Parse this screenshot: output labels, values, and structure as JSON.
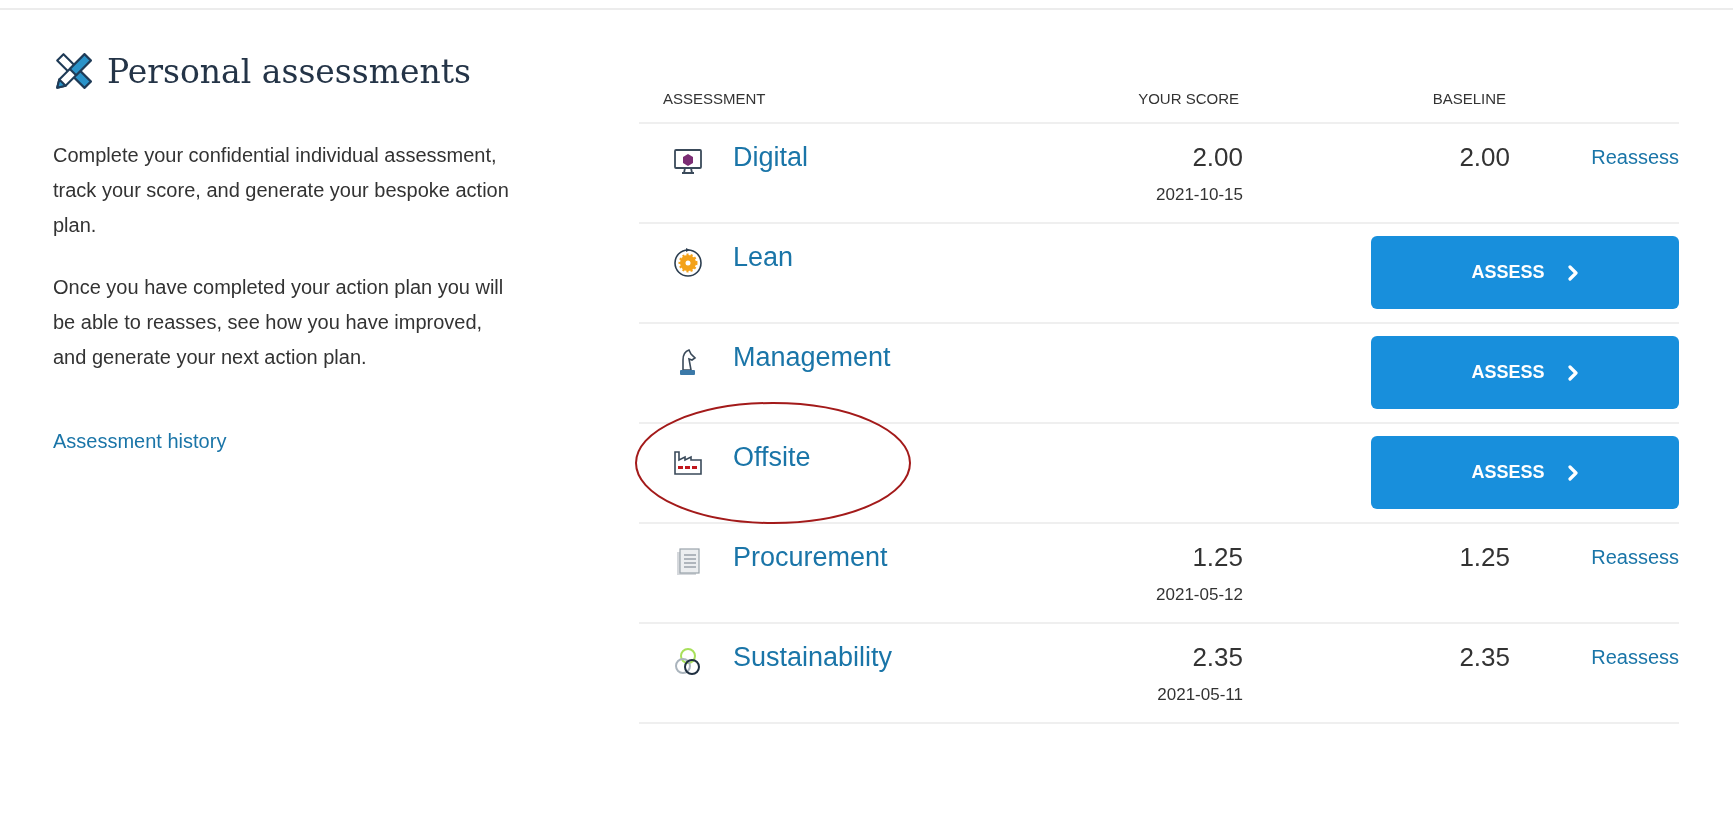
{
  "intro": {
    "title": "Personal assessments",
    "paragraphs": [
      "Complete your confidential individual assessment, track your score, and generate your bespoke action plan.",
      "Once you have completed your action plan you will be able to reasses, see how you have improved, and generate your next action plan."
    ],
    "history_link": "Assessment history"
  },
  "table": {
    "columns": [
      "ASSESSMENT",
      "YOUR SCORE",
      "BASELINE"
    ],
    "rows": [
      {
        "kind": "scored",
        "name": "Digital",
        "score": "2.00",
        "date": "2021-10-15",
        "baseline": "2.00",
        "action": "Reassess",
        "circled": false
      },
      {
        "kind": "new",
        "name": "Lean",
        "action": "ASSESS",
        "circled": false
      },
      {
        "kind": "new",
        "name": "Management",
        "action": "ASSESS",
        "circled": false
      },
      {
        "kind": "new",
        "name": "Offsite",
        "action": "ASSESS",
        "circled": true
      },
      {
        "kind": "scored",
        "name": "Procurement",
        "score": "1.25",
        "date": "2021-05-12",
        "baseline": "1.25",
        "action": "Reassess",
        "circled": false
      },
      {
        "kind": "scored",
        "name": "Sustainability",
        "score": "2.35",
        "date": "2021-05-11",
        "baseline": "2.35",
        "action": "Reassess",
        "circled": false
      }
    ]
  }
}
